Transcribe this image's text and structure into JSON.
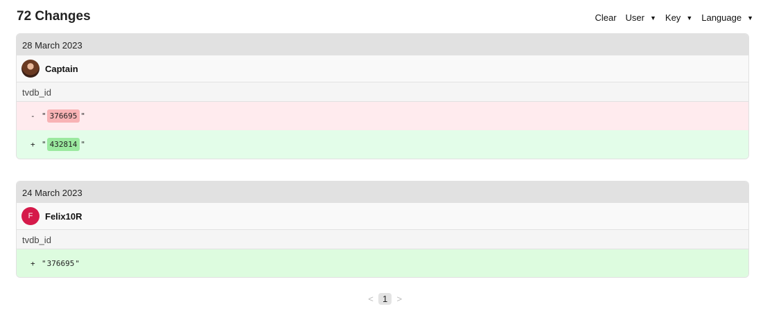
{
  "header": {
    "title": "72 Changes",
    "filters": {
      "clear": "Clear",
      "user": "User",
      "key": "Key",
      "language": "Language"
    }
  },
  "changes": [
    {
      "date": "28 March 2023",
      "user": "Captain",
      "key": "tvdb_id",
      "removed": "376695",
      "added": "432814"
    },
    {
      "date": "24 March 2023",
      "user": "Felix10R",
      "avatar_letter": "F",
      "key": "tvdb_id",
      "added": "376695"
    }
  ],
  "diff": {
    "minus": "-",
    "plus": "+",
    "quote": "\""
  },
  "pagination": {
    "prev": "<",
    "current": "1",
    "next": ">"
  },
  "colors": {
    "removed_bg": "#ffebee",
    "added_bg": "#e3fde9",
    "removed_highlight": "#f8b3b5",
    "added_highlight": "#9be99f",
    "avatar_felix": "#d51a4a"
  },
  "icons": {
    "dropdown": "caret-down-icon"
  }
}
